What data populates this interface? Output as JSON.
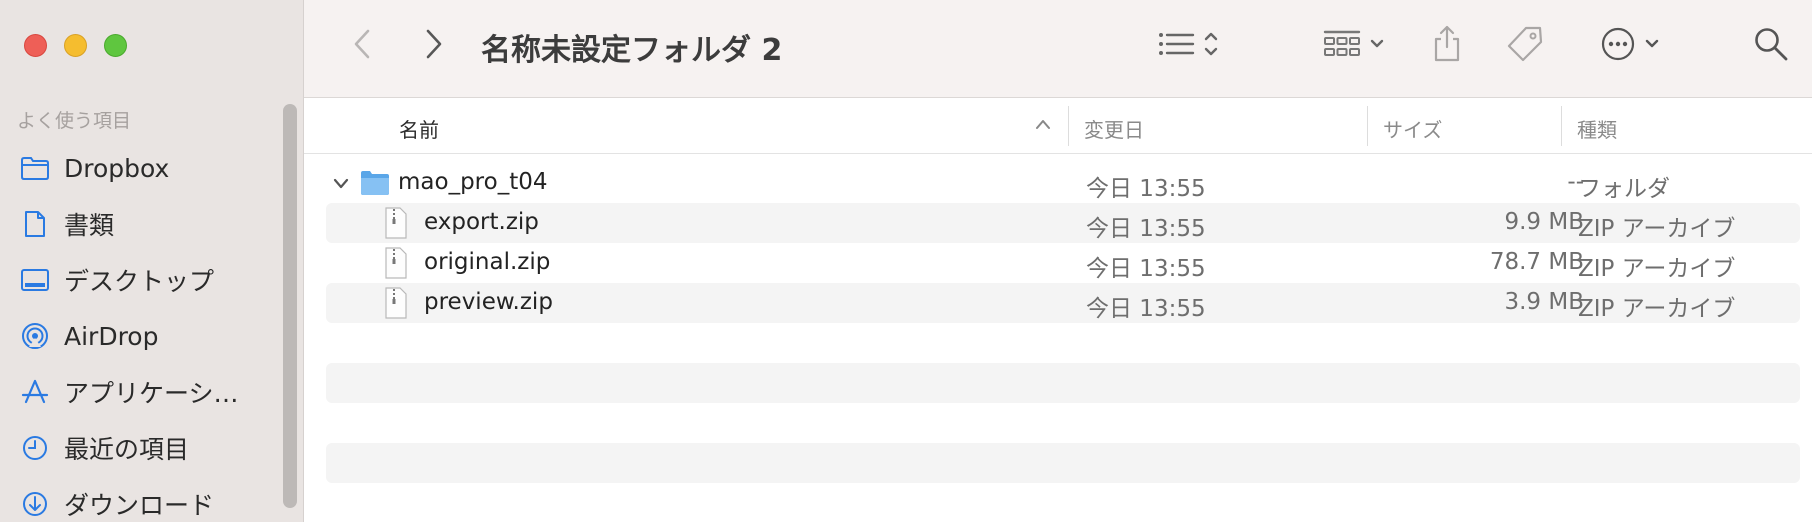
{
  "window": {
    "title": "名称未設定フォルダ 2"
  },
  "sidebar": {
    "section_label": "よく使う項目",
    "items": [
      {
        "label": "Dropbox",
        "icon": "folder-icon"
      },
      {
        "label": "書類",
        "icon": "document-icon"
      },
      {
        "label": "デスクトップ",
        "icon": "desktop-icon"
      },
      {
        "label": "AirDrop",
        "icon": "airdrop-icon"
      },
      {
        "label": "アプリケーシ…",
        "icon": "applications-icon"
      },
      {
        "label": "最近の項目",
        "icon": "clock-icon"
      },
      {
        "label": "ダウンロード",
        "icon": "download-icon"
      }
    ]
  },
  "columns": {
    "name": "名前",
    "date": "変更日",
    "size": "サイズ",
    "kind": "種類"
  },
  "rows": [
    {
      "name": "mao_pro_t04",
      "date": "今日 13:55",
      "size": "--",
      "kind": "フォルダ",
      "type": "folder"
    },
    {
      "name": "export.zip",
      "date": "今日 13:55",
      "size": "9.9 MB",
      "kind": "ZIP アーカイブ",
      "type": "zip"
    },
    {
      "name": "original.zip",
      "date": "今日 13:55",
      "size": "78.7 MB",
      "kind": "ZIP アーカイブ",
      "type": "zip"
    },
    {
      "name": "preview.zip",
      "date": "今日 13:55",
      "size": "3.9 MB",
      "kind": "ZIP アーカイブ",
      "type": "zip"
    }
  ],
  "colors": {
    "accent": "#2a7ae2",
    "sidebar_bg": "#e9e4e2",
    "folder": "#6fb3ee"
  }
}
